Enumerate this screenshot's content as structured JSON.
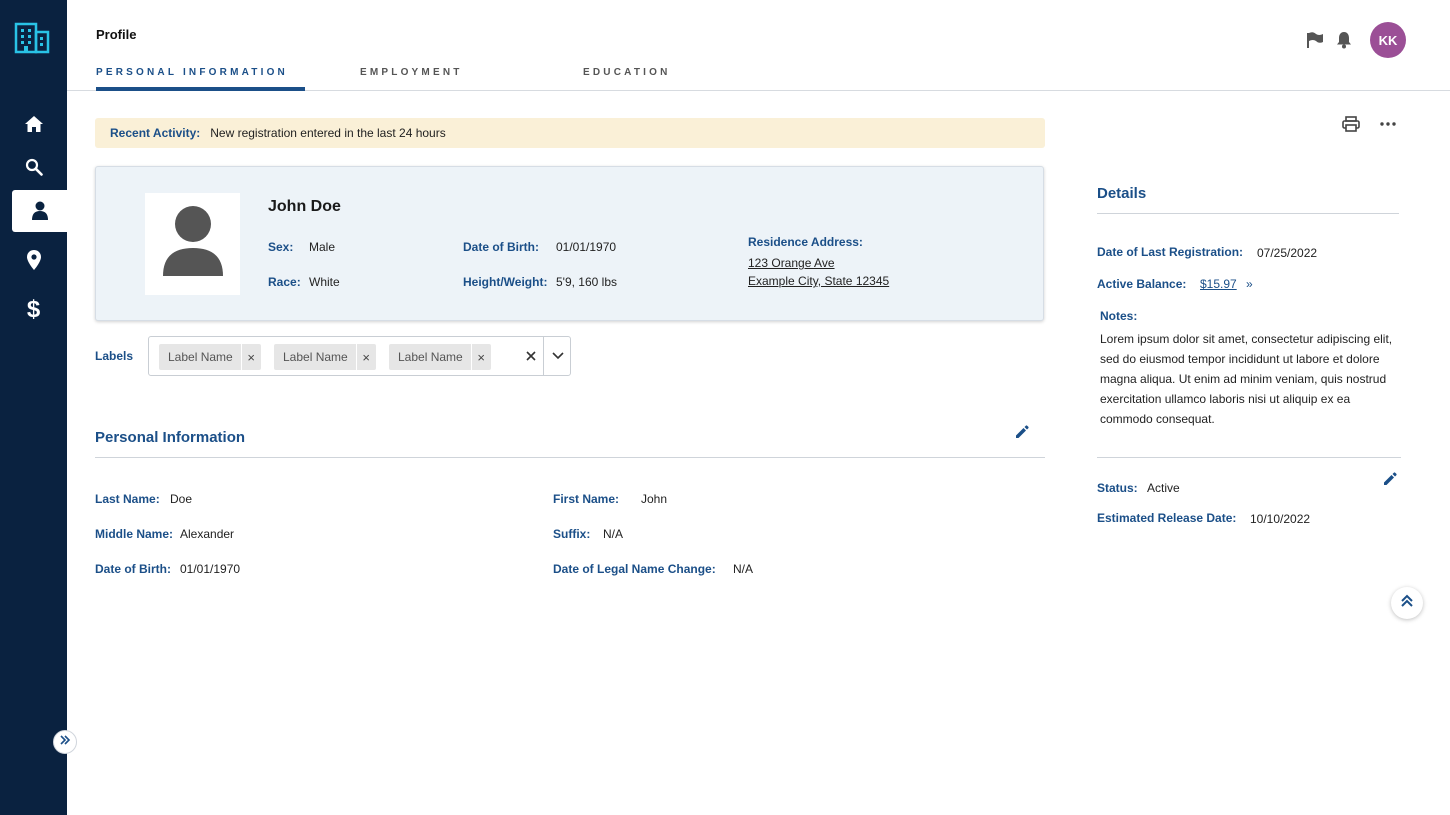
{
  "colors": {
    "sidebar_bg": "#0a2240",
    "brand_blue": "#1b4f88",
    "banner_bg": "#faf0d7",
    "card_bg": "#edf3f8",
    "avatar_bg": "#9b4f96",
    "logo_cyan": "#29c3e6"
  },
  "sidebar": {
    "logo_icon": "building-icon",
    "items": [
      {
        "icon": "home-icon",
        "active": false
      },
      {
        "icon": "search-icon",
        "active": false
      },
      {
        "icon": "person-icon",
        "active": true
      },
      {
        "icon": "location-pin-icon",
        "active": false
      },
      {
        "icon": "dollar-icon",
        "active": false
      }
    ],
    "collapse_icon": "double-chevron-right-icon"
  },
  "header": {
    "title": "Profile",
    "tabs": [
      {
        "label": "PERSONAL INFORMATION",
        "active": true
      },
      {
        "label": "EMPLOYMENT",
        "active": false
      },
      {
        "label": "EDUCATION",
        "active": false
      }
    ],
    "icons": [
      "flag-icon",
      "bell-icon"
    ],
    "avatar_initials": "KK"
  },
  "banner": {
    "label": "Recent Activity:",
    "text": "New registration entered in the last 24 hours"
  },
  "profile_card": {
    "name": "John Doe",
    "sex_label": "Sex:",
    "sex": "Male",
    "race_label": "Race:",
    "race": "White",
    "dob_label": "Date of Birth:",
    "dob": "01/01/1970",
    "hw_label": "Height/Weight:",
    "hw": "5'9, 160 lbs",
    "address_label": "Residence Address:",
    "address_line1": "123 Orange Ave",
    "address_line2": "Example City, State 12345"
  },
  "labels": {
    "title": "Labels",
    "chips": [
      "Label Name",
      "Label Name",
      "Label Name"
    ],
    "chip_remove": "×"
  },
  "personal_info": {
    "title": "Personal Information",
    "fields": [
      {
        "label": "Last Name:",
        "value": "Doe"
      },
      {
        "label": "First Name:",
        "value": "John"
      },
      {
        "label": "Middle Name:",
        "value": "Alexander"
      },
      {
        "label": "Suffix:",
        "value": "N/A"
      },
      {
        "label": "Date of Birth:",
        "value": "01/01/1970"
      },
      {
        "label": "Date of Legal Name Change:",
        "value": "N/A"
      }
    ]
  },
  "details": {
    "actions": [
      "printer-icon",
      "more-horizontal-icon"
    ],
    "title": "Details",
    "last_reg_label": "Date of Last Registration:",
    "last_reg": "07/25/2022",
    "balance_label": "Active Balance:",
    "balance": "$15.97",
    "balance_arrow": "»",
    "notes_label": "Notes:",
    "notes": "Lorem ipsum dolor sit amet, consectetur adipiscing elit, sed do eiusmod tempor incididunt ut labore et dolore magna aliqua. Ut enim ad minim veniam, quis nostrud exercitation ullamco laboris nisi ut aliquip ex ea commodo consequat.",
    "status_label": "Status:",
    "status": "Active",
    "release_label": "Estimated Release Date:",
    "release": "10/10/2022"
  }
}
